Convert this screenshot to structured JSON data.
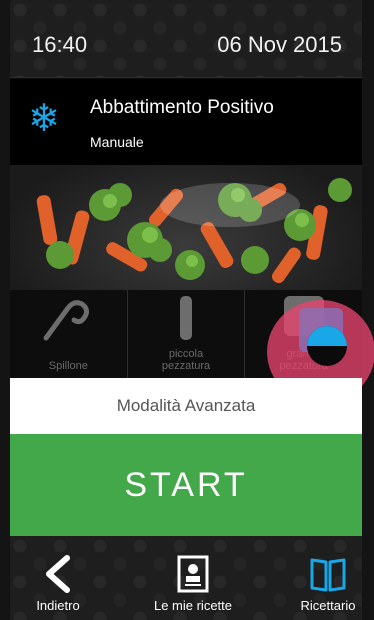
{
  "status_bar": {
    "time": "16:40",
    "date": "06 Nov 2015"
  },
  "program": {
    "icon": "snowflake-icon",
    "title": "Abbattimento Positivo",
    "mode": "Manuale",
    "icon_color": "#1aa7e8"
  },
  "photo": {
    "description_icon": "food-photo"
  },
  "options": [
    {
      "label": "Spillone",
      "icon": "probe-icon"
    },
    {
      "label_line1": "piccola",
      "label_line2": "pezzatura",
      "icon": "small-size-icon"
    },
    {
      "label_line1": "grande",
      "label_line2": "pezzatura",
      "icon": "large-size-icon"
    }
  ],
  "advanced": {
    "label": "Modalità Avanzata"
  },
  "start": {
    "label": "START",
    "color": "#42a84a"
  },
  "nav": {
    "back": {
      "label": "Indietro",
      "icon": "chevron-left-icon"
    },
    "my_recipes": {
      "label": "Le mie ricette",
      "icon": "contact-card-icon"
    },
    "recipe_book": {
      "label": "Ricettario",
      "icon": "book-icon"
    }
  },
  "colors": {
    "accent_blue": "#1aa7e8",
    "tap_highlight": "#e8446e"
  }
}
